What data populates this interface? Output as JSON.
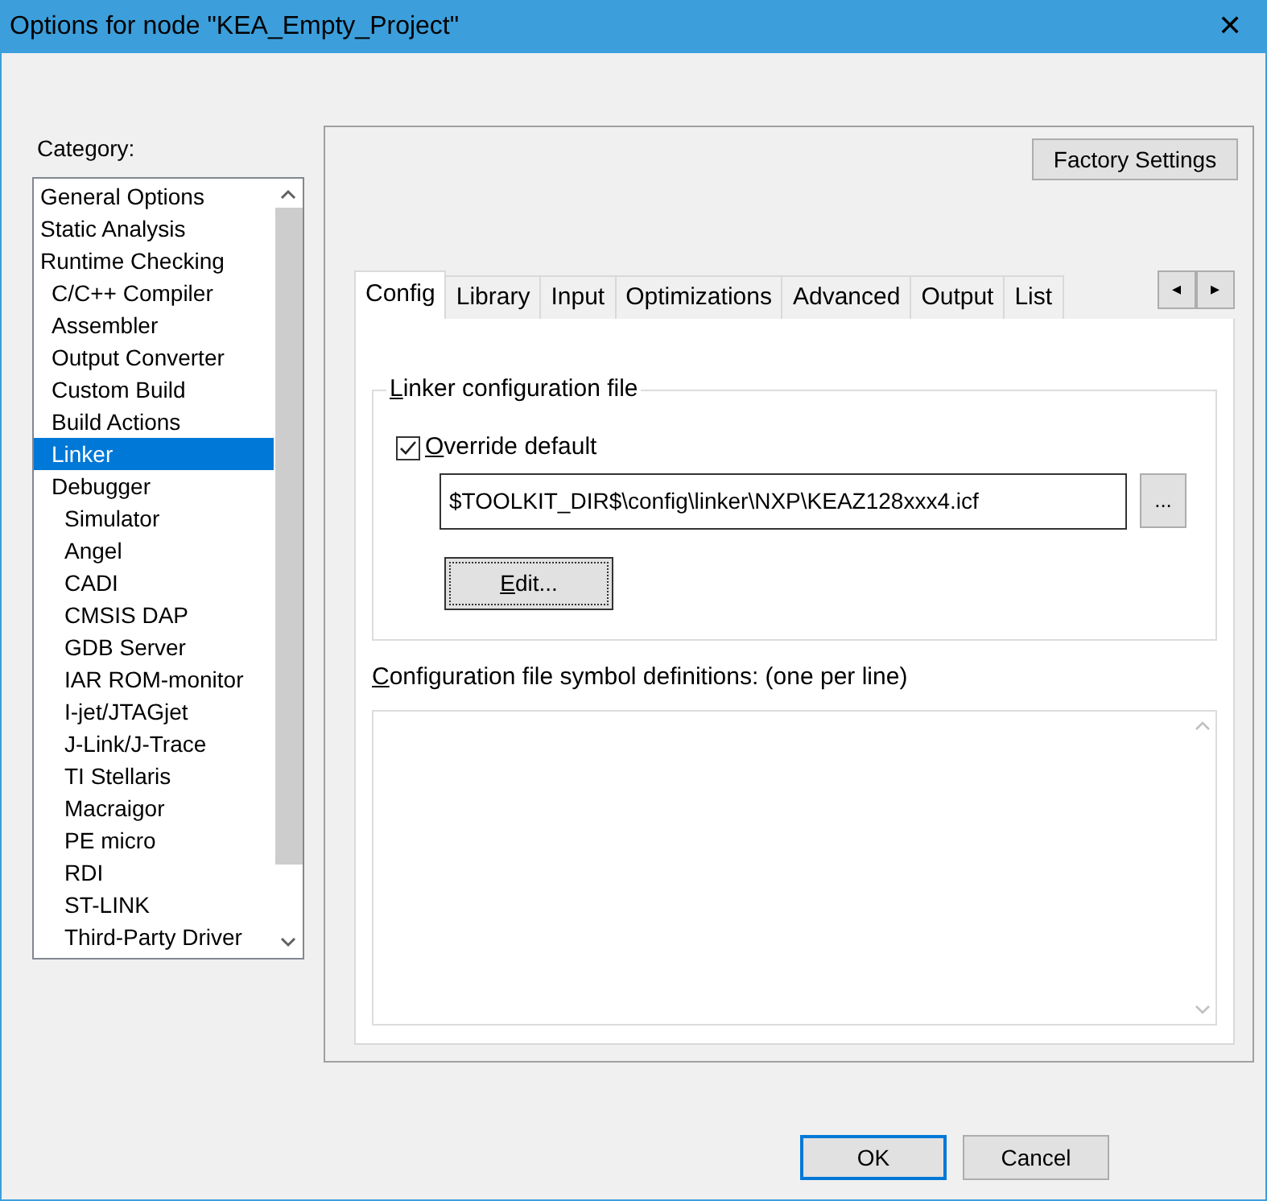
{
  "window": {
    "title": "Options for node \"KEA_Empty_Project\"",
    "close": "✕"
  },
  "category": {
    "label": "Category:",
    "items": [
      {
        "label": "General Options",
        "selected": false
      },
      {
        "label": "Static Analysis",
        "selected": false
      },
      {
        "label": "Runtime Checking",
        "selected": false,
        "children": [
          {
            "label": "C/C++ Compiler",
            "selected": false
          },
          {
            "label": "Assembler",
            "selected": false
          },
          {
            "label": "Output Converter",
            "selected": false
          },
          {
            "label": "Custom Build",
            "selected": false
          },
          {
            "label": "Build Actions",
            "selected": false
          },
          {
            "label": "Linker",
            "selected": true
          },
          {
            "label": "Debugger",
            "selected": false,
            "children": [
              {
                "label": "Simulator",
                "selected": false
              },
              {
                "label": "Angel",
                "selected": false
              },
              {
                "label": "CADI",
                "selected": false
              },
              {
                "label": "CMSIS DAP",
                "selected": false
              },
              {
                "label": "GDB Server",
                "selected": false
              },
              {
                "label": "IAR ROM-monitor",
                "selected": false
              },
              {
                "label": "I-jet/JTAGjet",
                "selected": false
              },
              {
                "label": "J-Link/J-Trace",
                "selected": false
              },
              {
                "label": "TI Stellaris",
                "selected": false
              },
              {
                "label": "Macraigor",
                "selected": false
              },
              {
                "label": "PE micro",
                "selected": false
              },
              {
                "label": "RDI",
                "selected": false
              },
              {
                "label": "ST-LINK",
                "selected": false
              },
              {
                "label": "Third-Party Driver",
                "selected": false
              }
            ]
          }
        ]
      }
    ]
  },
  "factory_settings": "Factory Settings",
  "tabs": [
    {
      "label": "Config",
      "selected": true
    },
    {
      "label": "Library",
      "selected": false
    },
    {
      "label": "Input",
      "selected": false
    },
    {
      "label": "Optimizations",
      "selected": false
    },
    {
      "label": "Advanced",
      "selected": false
    },
    {
      "label": "Output",
      "selected": false
    },
    {
      "label": "List",
      "selected": false
    }
  ],
  "tab_scroll": [
    "◂",
    "▸"
  ],
  "linker_group": {
    "title": "Linker configuration file",
    "underline_first": true,
    "override": {
      "label": "Override default",
      "checked": true,
      "underline_first": true
    },
    "file": "$TOOLKIT_DIR$\\config\\linker\\NXP\\KEAZ128xxx4.icf",
    "browse": "...",
    "edit": {
      "label": "Edit...",
      "underline_first": true
    }
  },
  "symbols": {
    "label": "Configuration file symbol definitions: (one per line)",
    "underline_first": true
  },
  "buttons": [
    {
      "label": "OK",
      "default": true
    },
    {
      "label": "Cancel",
      "default": false
    }
  ]
}
